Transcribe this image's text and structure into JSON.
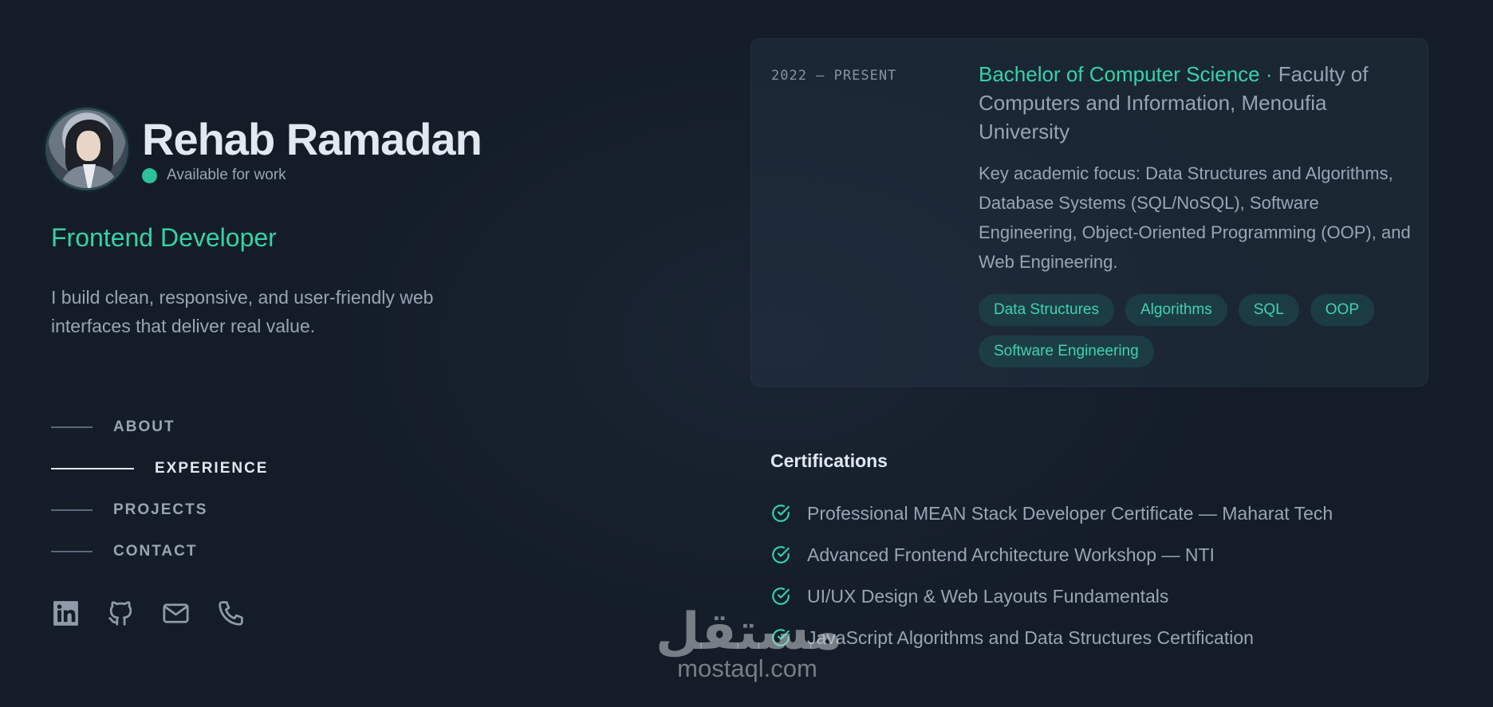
{
  "profile": {
    "name": "Rehab Ramadan",
    "status": "Available for work",
    "role": "Frontend Developer",
    "tagline": "I build clean, responsive, and user-friendly web interfaces that deliver real value."
  },
  "nav": {
    "items": [
      {
        "label": "ABOUT",
        "active": false
      },
      {
        "label": "EXPERIENCE",
        "active": true
      },
      {
        "label": "PROJECTS",
        "active": false
      },
      {
        "label": "CONTACT",
        "active": false
      }
    ]
  },
  "socials": [
    "linkedin-icon",
    "github-icon",
    "mail-icon",
    "phone-icon"
  ],
  "education": {
    "date": "2022 — PRESENT",
    "degree": "Bachelor of Computer Science",
    "separator": " · ",
    "institution": "Faculty of Computers and Information, Menoufia University",
    "description": "Key academic focus: Data Structures and Algorithms, Database Systems (SQL/NoSQL), Software Engineering, Object-Oriented Programming (OOP), and Web Engineering.",
    "tags": [
      "Data Structures",
      "Algorithms",
      "SQL",
      "OOP",
      "Software Engineering"
    ]
  },
  "certifications": {
    "title": "Certifications",
    "items": [
      "Professional MEAN Stack Developer Certificate — Maharat Tech",
      "Advanced Frontend Architecture Workshop — NTI",
      "UI/UX Design & Web Layouts Fundamentals",
      "JavaScript Algorithms and Data Structures Certification"
    ]
  },
  "watermark": {
    "arabic": "مستقل",
    "latin": "mostaql.com"
  },
  "colors": {
    "background": "#131c27",
    "accent": "#34d3a6",
    "heading": "#e2e8f0",
    "body_text": "#9aa5b3"
  }
}
